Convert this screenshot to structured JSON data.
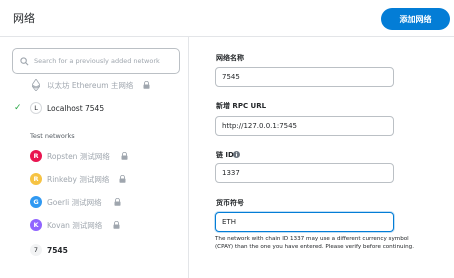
{
  "header": {
    "title": "网络",
    "add_network_label": "添加网络"
  },
  "search": {
    "placeholder": "Search for a previously added network"
  },
  "networks": {
    "mainnet": {
      "label": "以太坊 Ethereum 主网络"
    },
    "localhost": {
      "badge": "L",
      "label": "Localhost 7545",
      "selected": true
    },
    "test_section_label": "Test networks",
    "testnets": [
      {
        "badge": "R",
        "label": "Ropsten 测试网络",
        "color": "#e91550"
      },
      {
        "badge": "R",
        "label": "Rinkeby 测试网络",
        "color": "#f6c343"
      },
      {
        "badge": "G",
        "label": "Goerli 测试网络",
        "color": "#3099f2"
      },
      {
        "badge": "K",
        "label": "Kovan 测试网络",
        "color": "#9064ff"
      }
    ],
    "custom": {
      "badge": "7",
      "label": "7545"
    }
  },
  "form": {
    "network_name_label": "网络名称",
    "network_name_value": "7545",
    "rpc_url_label": "新增 RPC URL",
    "rpc_url_value": "http://127.0.0.1:7545",
    "chain_id_label": "链 ID",
    "chain_id_value": "1337",
    "currency_symbol_label": "货币符号",
    "currency_symbol_value": "ETH",
    "warning_text": "The network with chain ID 1337 may use a different currency symbol (CPAY) than the one you have entered. Please verify before continuing."
  },
  "colors": {
    "accent": "#037dd6",
    "check": "#28a745",
    "muted_text": "#9fa6ae"
  },
  "icons": [
    "search-icon",
    "ethereum-icon",
    "lock-icon",
    "check-icon",
    "info-icon"
  ]
}
